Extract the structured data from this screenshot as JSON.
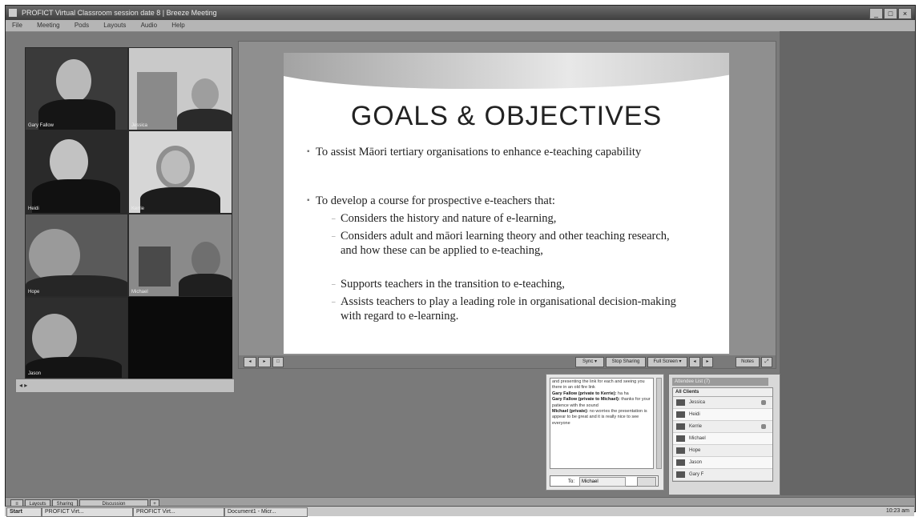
{
  "window": {
    "title": "PROFICT Virtual Classroom session date 8 | Breeze Meeting",
    "menu": [
      "File",
      "Meeting",
      "Pods",
      "Layouts",
      "Audio",
      "Help"
    ],
    "buttons": [
      "_",
      "□",
      "×"
    ]
  },
  "video": {
    "participants": [
      {
        "name": "Gary Fallow"
      },
      {
        "name": "Jessica"
      },
      {
        "name": "Heidi"
      },
      {
        "name": "Kerrie"
      },
      {
        "name": "Hope"
      },
      {
        "name": "Michael"
      },
      {
        "name": "Jason"
      }
    ],
    "scroll_label": "◂ ▸"
  },
  "slide": {
    "title": "GOALS & OBJECTIVES",
    "bullets": [
      {
        "text": "To assist Māori tertiary organisations to enhance e-teaching capability",
        "subs": []
      },
      {
        "text": "To develop a course for prospective e-teachers that:",
        "subs": [
          "Considers the history and nature of e-learning,",
          "Considers adult and māori learning theory and other teaching research, and how these can be applied to e-teaching,",
          "Supports teachers in the transition to e-teaching,",
          "Assists teachers to play a leading role in organisational decision-making with regard to e-learning."
        ]
      }
    ],
    "controls": [
      "◂",
      "▸",
      "□",
      "Sync ▾",
      "Stop Sharing",
      "Full Screen ▾",
      "◂",
      "▸",
      "Notes",
      "⤢"
    ]
  },
  "chat": {
    "messages": [
      {
        "from": "",
        "text": "and presenting the link for each and seeing you there in an old fire link"
      },
      {
        "from": "Gary Fallow (private to Kerrie):",
        "text": "ha ha"
      },
      {
        "from": "Gary Fallow (private to Michael):",
        "text": "thanks for your patience with the sound"
      },
      {
        "from": "Michael (private):",
        "text": "no worries the presentation is appear to be great and it is really nice to see everyone"
      }
    ],
    "to_label": "To:",
    "recipient": "Michael"
  },
  "attendees": {
    "header": "Attendee List (7)",
    "group": "All Clients",
    "list": [
      {
        "name": "Jessica"
      },
      {
        "name": "Heidi"
      },
      {
        "name": "Kerrie"
      },
      {
        "name": "Michael"
      },
      {
        "name": "Hope"
      },
      {
        "name": "Jason"
      },
      {
        "name": "Gary F"
      }
    ]
  },
  "footer": {
    "left": [
      "≡",
      "Layouts",
      "Sharing",
      "Discussion",
      "+"
    ]
  },
  "taskbar": {
    "start": "Start",
    "items": [
      "PROFICT Virt...",
      "PROFICT Virt...",
      "Document1 - Micr..."
    ],
    "clock": "10:23 am"
  }
}
